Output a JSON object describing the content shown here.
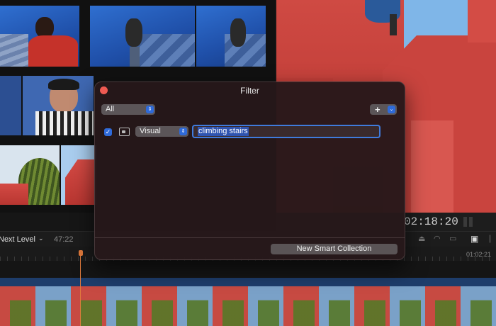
{
  "dialog": {
    "title": "Filter",
    "match_value": "All",
    "rule": {
      "enabled": true,
      "type": "Visual",
      "query": "climbing stairs"
    },
    "add_button_glyph": "+",
    "new_collection_label": "New Smart Collection"
  },
  "timeline": {
    "zoom_label": "Next Level",
    "duration": "47:22",
    "timecode": "02:18:20",
    "ruler_time": "01:02:21"
  },
  "colors": {
    "accent": "#2f6ad9",
    "selection": "#2f54b0",
    "close": "#ee5a52",
    "playhead": "#e07a3c"
  },
  "icons": [
    "close-icon",
    "checkbox-icon",
    "visual-search-icon",
    "stepper-icon",
    "plus-icon",
    "chevron-down-icon",
    "headphones-icon",
    "filmstrip-icon"
  ]
}
